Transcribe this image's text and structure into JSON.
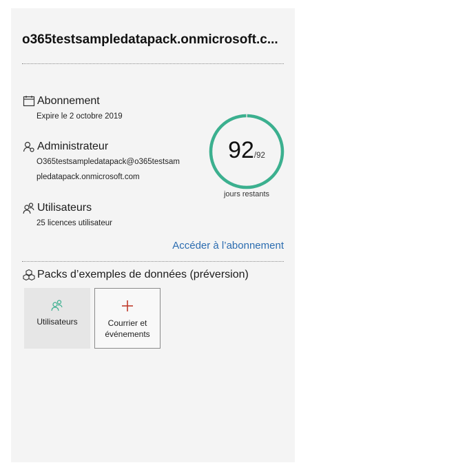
{
  "header": {
    "domain": "o365testsampledatapack.onmicrosoft.c..."
  },
  "subscription": {
    "title": "Abonnement",
    "detail": "Expire le 2 octobre 2019"
  },
  "admin": {
    "title": "Administrateur",
    "email_line1": "O365testsampledatapack@o365testsam",
    "email_line2": "pledatapack.onmicrosoft.com"
  },
  "users": {
    "title": "Utilisateurs",
    "detail": "25 licences utilisateur"
  },
  "days": {
    "remaining": "92",
    "total": "/92",
    "caption": "jours restants",
    "fraction": 1.0,
    "color": "#3bb08f"
  },
  "link": {
    "subscription": "Accéder à l’abonnement"
  },
  "packs": {
    "title": "Packs d’exemples de données (préversion)",
    "tiles": [
      {
        "label": "Utilisateurs",
        "icon": "users-icon"
      },
      {
        "label": "Courrier et événements",
        "icon": "plus-icon"
      }
    ]
  },
  "colors": {
    "accent_green": "#3bb08f",
    "link_blue": "#2b6cb0",
    "plus_red": "#c0392b"
  }
}
